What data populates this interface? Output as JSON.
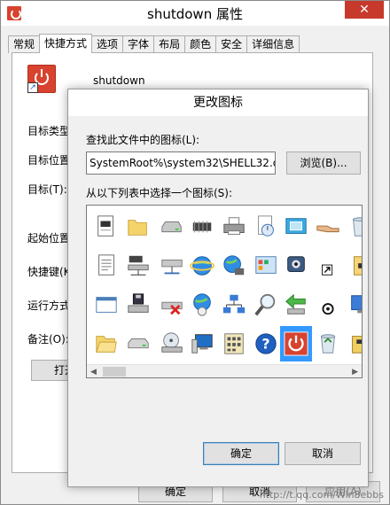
{
  "window": {
    "title": "shutdown 属性",
    "close_glyph": "✕"
  },
  "tabs": [
    {
      "label": "常规",
      "active": false
    },
    {
      "label": "快捷方式",
      "active": true
    },
    {
      "label": "选项",
      "active": false
    },
    {
      "label": "字体",
      "active": false
    },
    {
      "label": "布局",
      "active": false
    },
    {
      "label": "颜色",
      "active": false
    },
    {
      "label": "安全",
      "active": false
    },
    {
      "label": "详细信息",
      "active": false
    }
  ],
  "shortcut": {
    "name": "shutdown",
    "labels": {
      "target_type": "目标类型",
      "target_location": "目标位置",
      "target": "目标(T):",
      "start_in": "起始位置",
      "shortcut_key": "快捷键(K",
      "run": "运行方式",
      "comment": "备注(O):"
    },
    "open_button": "打开"
  },
  "bottom_buttons": {
    "ok": "确定",
    "cancel": "取消",
    "apply": "应用(A)"
  },
  "watermark": "http://t.qq.com/Win8ebbs",
  "dialog": {
    "title": "更改图标",
    "find_label": "查找此文件中的图标(L):",
    "path_value": "SystemRoot%\\system32\\SHELL32.dll",
    "browse_button": "浏览(B)...",
    "list_label": "从以下列表中选择一个图标(S):",
    "ok_button": "确定",
    "cancel_button": "取消",
    "selected_icon": "power-icon",
    "icons": [
      [
        "blank-document-icon",
        "folder-icon",
        "drive-icon",
        "chip-icon",
        "printer-icon",
        "clock-document-icon",
        "monitor-frame-icon",
        "shared-hand-icon",
        "recycle-bin-empty-icon"
      ],
      [
        "text-document-icon",
        "network-drive-icon",
        "shared-drive-icon",
        "internet-globe-icon",
        "network-globe-icon",
        "control-panel-icon",
        "webcam-icon",
        "shortcut-arrow-icon",
        "folder-box-icon"
      ],
      [
        "window-icon",
        "floppy-drive-icon",
        "disconnected-drive-icon",
        "globe-mouse-icon",
        "network-icon",
        "magnifier-icon",
        "green-arrow-icon",
        "cd-small-icon",
        "blue-monitor-icon"
      ],
      [
        "folder-open-icon",
        "hard-disk-icon",
        "cd-drive-icon",
        "computer-icon",
        "calculator-grid-icon",
        "help-icon",
        "power-icon",
        "recycle-bin-icon",
        "toolbox-icon"
      ]
    ]
  }
}
